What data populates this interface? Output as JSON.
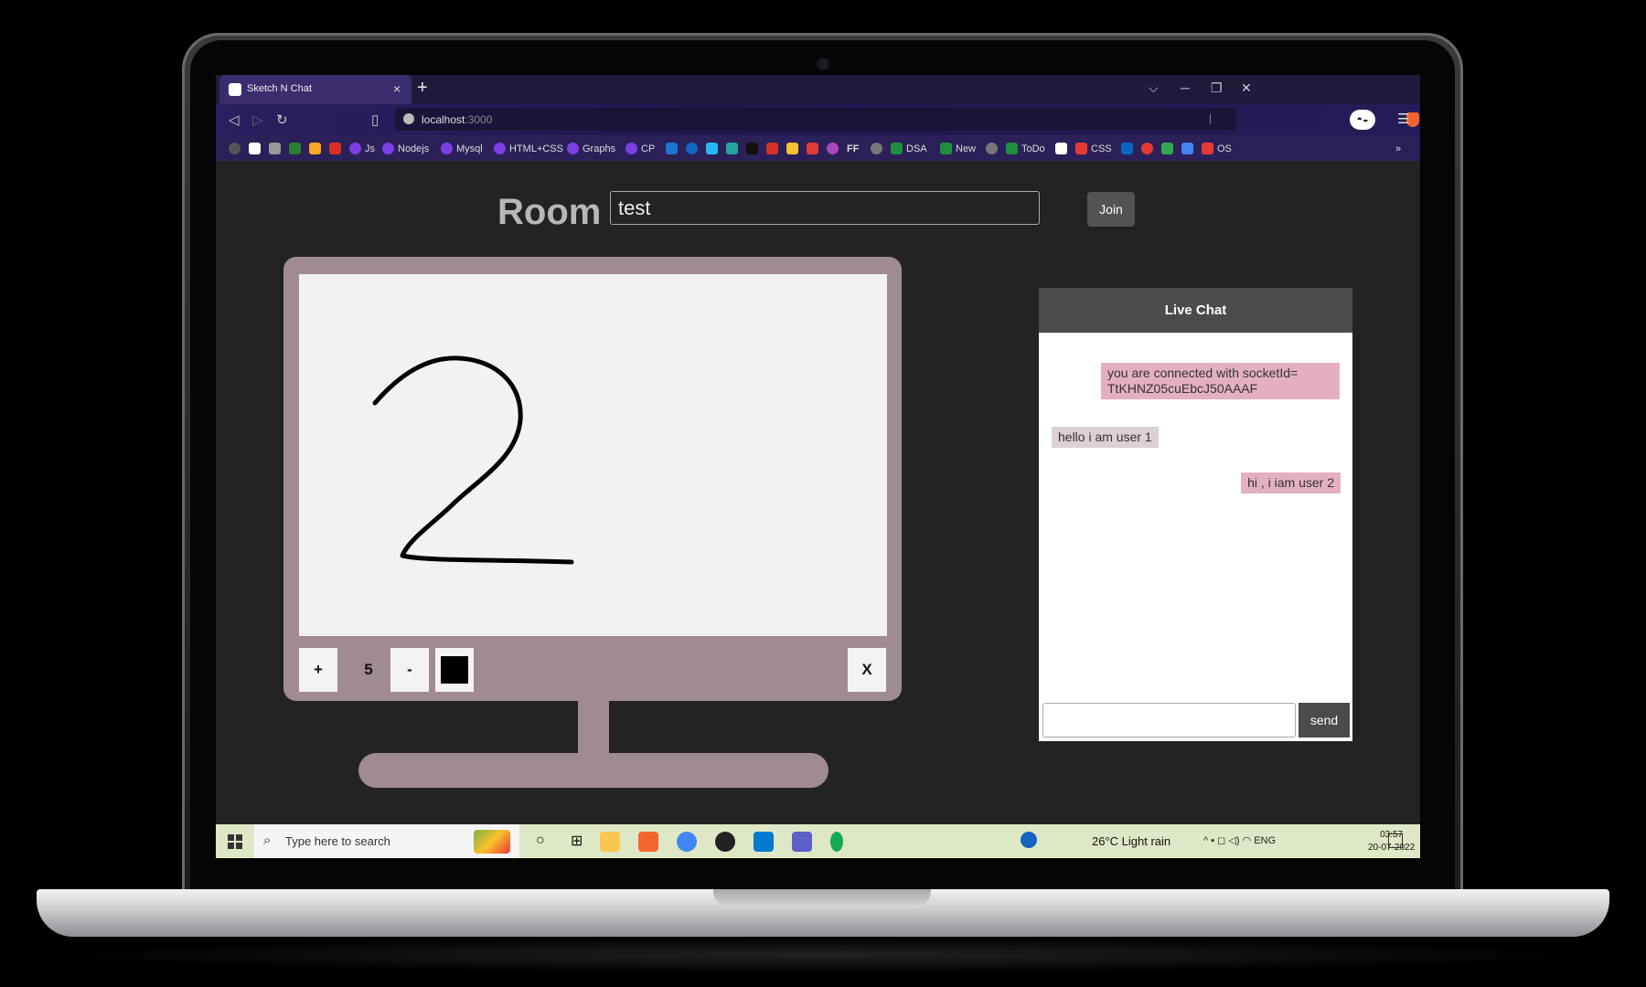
{
  "browser": {
    "tab_title": "Sketch N Chat",
    "tab_close": "×",
    "new_tab": "+",
    "url_host": "localhost",
    "url_port": ":3000",
    "window_controls": [
      "⌵",
      "─",
      "❐",
      "✕"
    ],
    "bookmarks": [
      {
        "label": "Js",
        "color": "#7b3fe4"
      },
      {
        "label": "Nodejs",
        "color": "#7b3fe4"
      },
      {
        "label": "Mysql",
        "color": "#7b3fe4"
      },
      {
        "label": "HTML+CSS",
        "color": "#7b3fe4"
      },
      {
        "label": "Graphs",
        "color": "#7b3fe4"
      },
      {
        "label": "CP",
        "color": "#7b3fe4"
      },
      {
        "label": "FF",
        "color": "#222222"
      },
      {
        "label": "DSA",
        "color": "#1e8e3e"
      },
      {
        "label": "New",
        "color": "#1e8e3e"
      },
      {
        "label": "ToDo",
        "color": "#1e8e3e"
      },
      {
        "label": "CSS",
        "color": "#e53935"
      },
      {
        "label": "OS",
        "color": "#e53935"
      }
    ],
    "bookmarks_more": "»"
  },
  "page": {
    "room_label": "Room",
    "room_value": "test",
    "join_label": "Join",
    "canvas": {
      "plus_label": "+",
      "brush_size": "5",
      "minus_label": "-",
      "clear_label": "X",
      "brush_color": "#000000"
    },
    "chat": {
      "title": "Live Chat",
      "messages": [
        {
          "text": "you are connected with socketId= TtKHNZ05cuEbcJ50AAAF",
          "own": true
        },
        {
          "text": "hello i am user 1",
          "own": false
        },
        {
          "text": "hi , i iam user 2",
          "own": true
        }
      ],
      "input_value": "",
      "send_label": "send"
    }
  },
  "taskbar": {
    "search_placeholder": "Type here to search",
    "weather": "26°C  Light rain",
    "language": "ENG",
    "time": "03:57",
    "date": "20-07-2022"
  },
  "colors": {
    "monitor": "#a08b90",
    "own_message": "#e4b0bf",
    "other_message": "#dcd0d3",
    "page_bg": "#232325",
    "chat_header": "#4b4b4d"
  }
}
